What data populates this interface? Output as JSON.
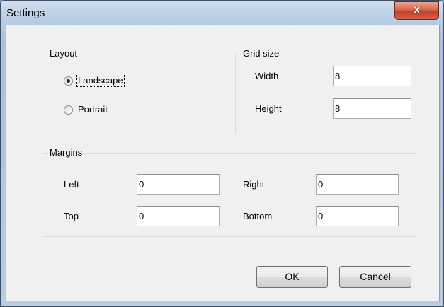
{
  "window": {
    "title": "Settings",
    "close_label": "X"
  },
  "layout_group": {
    "legend": "Layout",
    "options": [
      {
        "label": "Landscape",
        "selected": true
      },
      {
        "label": "Portrait",
        "selected": false
      }
    ]
  },
  "grid_group": {
    "legend": "Grid size",
    "width_label": "Width",
    "width_value": "8",
    "height_label": "Height",
    "height_value": "8"
  },
  "margins_group": {
    "legend": "Margins",
    "left_label": "Left",
    "left_value": "0",
    "right_label": "Right",
    "right_value": "0",
    "top_label": "Top",
    "top_value": "0",
    "bottom_label": "Bottom",
    "bottom_value": "0"
  },
  "buttons": {
    "ok": "OK",
    "cancel": "Cancel"
  }
}
